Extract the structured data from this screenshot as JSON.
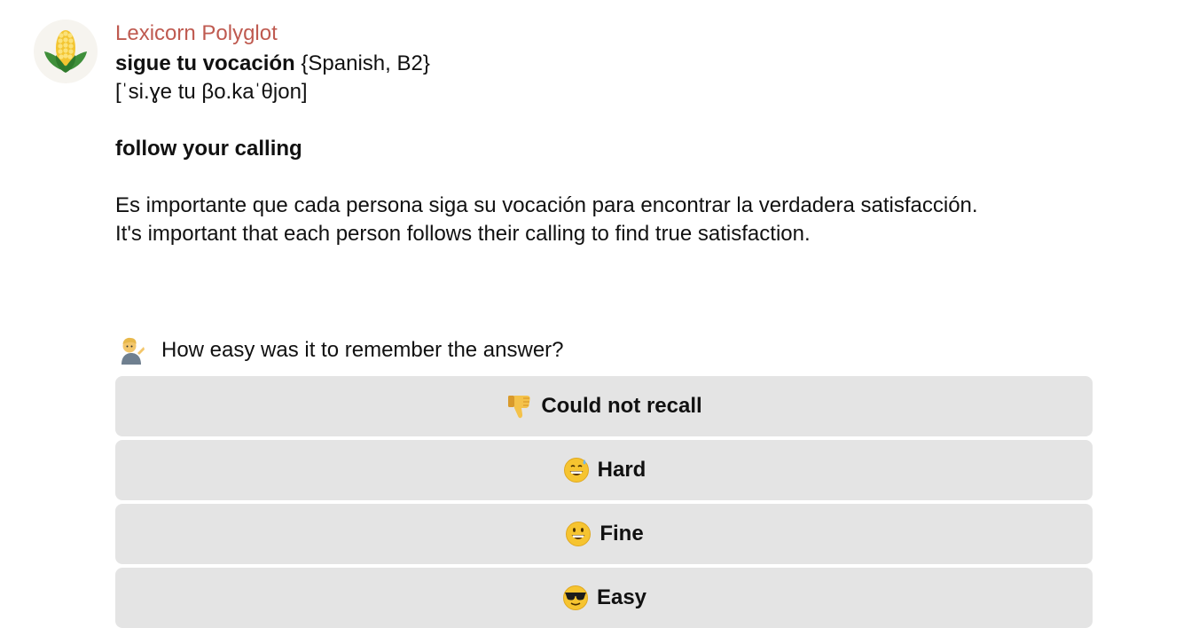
{
  "message": {
    "sender": "Lexicorn Polyglot",
    "term": "sigue tu vocación",
    "tag": "{Spanish, B2}",
    "ipa": "[ˈsi.ɣe tu βo.kaˈθjon]",
    "translation": "follow your calling",
    "example_es": "Es importante que cada persona siga su vocación para encontrar la verdadera satisfacción.",
    "example_en": "It's important that each person follows their calling to find true satisfaction."
  },
  "prompt": {
    "icon": "person-tipping-hand-icon",
    "text": "How easy was it to remember the answer?"
  },
  "buttons": [
    {
      "icon": "thumbs-down-icon",
      "label": "Could not recall"
    },
    {
      "icon": "grinning-sweat-face-icon",
      "label": "Hard"
    },
    {
      "icon": "grinning-face-icon",
      "label": "Fine"
    },
    {
      "icon": "sunglasses-face-icon",
      "label": "Easy"
    }
  ],
  "colors": {
    "sender": "#bf5a50",
    "button_bg": "#e4e4e4",
    "emoji_yellow": "#f6c430"
  }
}
